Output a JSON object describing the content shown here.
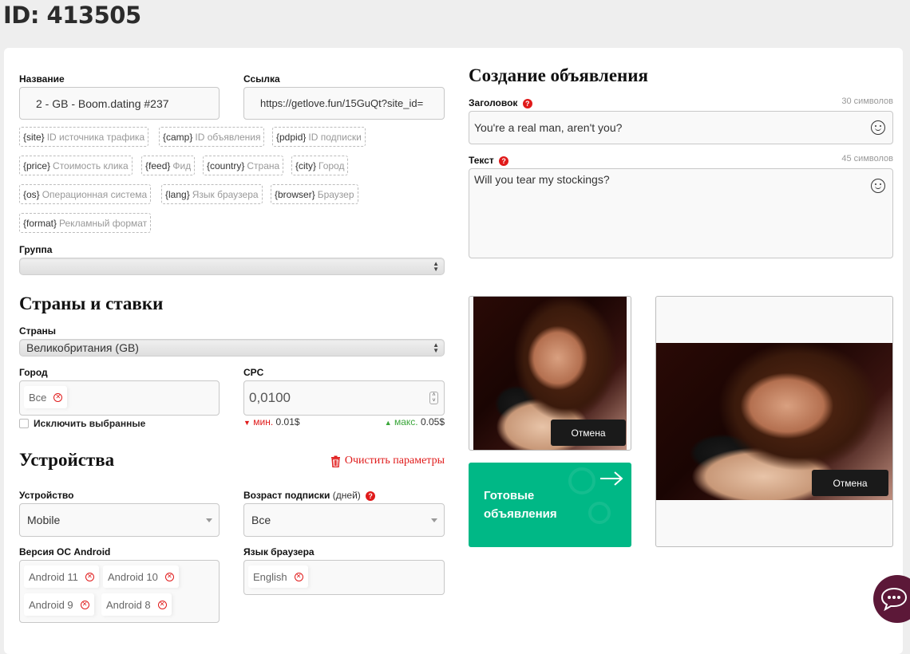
{
  "page": {
    "id_label": "ID: 413505"
  },
  "left": {
    "name": {
      "label": "Название",
      "value": "2 - GB - Boom.dating #237"
    },
    "link": {
      "label": "Ссылка",
      "value": "https://getlove.fun/15GuQt?site_id="
    },
    "variables": [
      {
        "key": "{site}",
        "desc": "ID источника трафика"
      },
      {
        "key": "{camp}",
        "desc": "ID объявления"
      },
      {
        "key": "{pdpid}",
        "desc": "ID подписки"
      },
      {
        "key": "{price}",
        "desc": "Стоимость клика"
      },
      {
        "key": "{feed}",
        "desc": "Фид"
      },
      {
        "key": "{country}",
        "desc": "Страна"
      },
      {
        "key": "{city}",
        "desc": "Город"
      },
      {
        "key": "{os}",
        "desc": "Операционная система"
      },
      {
        "key": "{lang}",
        "desc": "Язык браузера"
      },
      {
        "key": "{browser}",
        "desc": "Браузер"
      },
      {
        "key": "{format}",
        "desc": "Рекламный формат"
      }
    ],
    "group": {
      "label": "Группа",
      "value": ""
    },
    "countries_section": {
      "title": "Страны и ставки",
      "countries": {
        "label": "Страны",
        "value": "Великобритания (GB)"
      },
      "city": {
        "label": "Город",
        "tags": [
          "Все"
        ]
      },
      "exclude": {
        "label": "Исключить выбранные",
        "checked": false
      },
      "cpc": {
        "label": "CPC",
        "value": "0,0100",
        "min_label": "мин.",
        "min_value": "0.01$",
        "max_label": "макс.",
        "max_value": "0.05$"
      }
    },
    "devices_section": {
      "title": "Устройства",
      "clear_label": "Очистить параметры",
      "device": {
        "label": "Устройство",
        "value": "Mobile"
      },
      "sub_age": {
        "label": "Возраст подписки",
        "label_suffix": "(дней)",
        "value": "Все"
      },
      "os_version": {
        "label": "Версия ОС Android",
        "tags": [
          "Android 11",
          "Android 10",
          "Android 9",
          "Android 8"
        ]
      },
      "browser_lang": {
        "label": "Язык браузера",
        "tags": [
          "English"
        ]
      }
    }
  },
  "right": {
    "title": "Создание объявления",
    "headline": {
      "label": "Заголовок",
      "counter": "30 символов",
      "value": "You're a real man, aren't you?"
    },
    "text": {
      "label": "Текст",
      "counter": "45 символов",
      "value": "Will you tear my stockings?"
    },
    "image_cancel_label": "Отмена",
    "preview_cancel_label": "Отмена",
    "ready_ads": {
      "line1": "Готовые",
      "line2": "объявления"
    }
  },
  "colors": {
    "accent_red": "#e01a1a",
    "green": "#00b886",
    "chat": "#5c1838",
    "max_green": "#3aa63a"
  }
}
